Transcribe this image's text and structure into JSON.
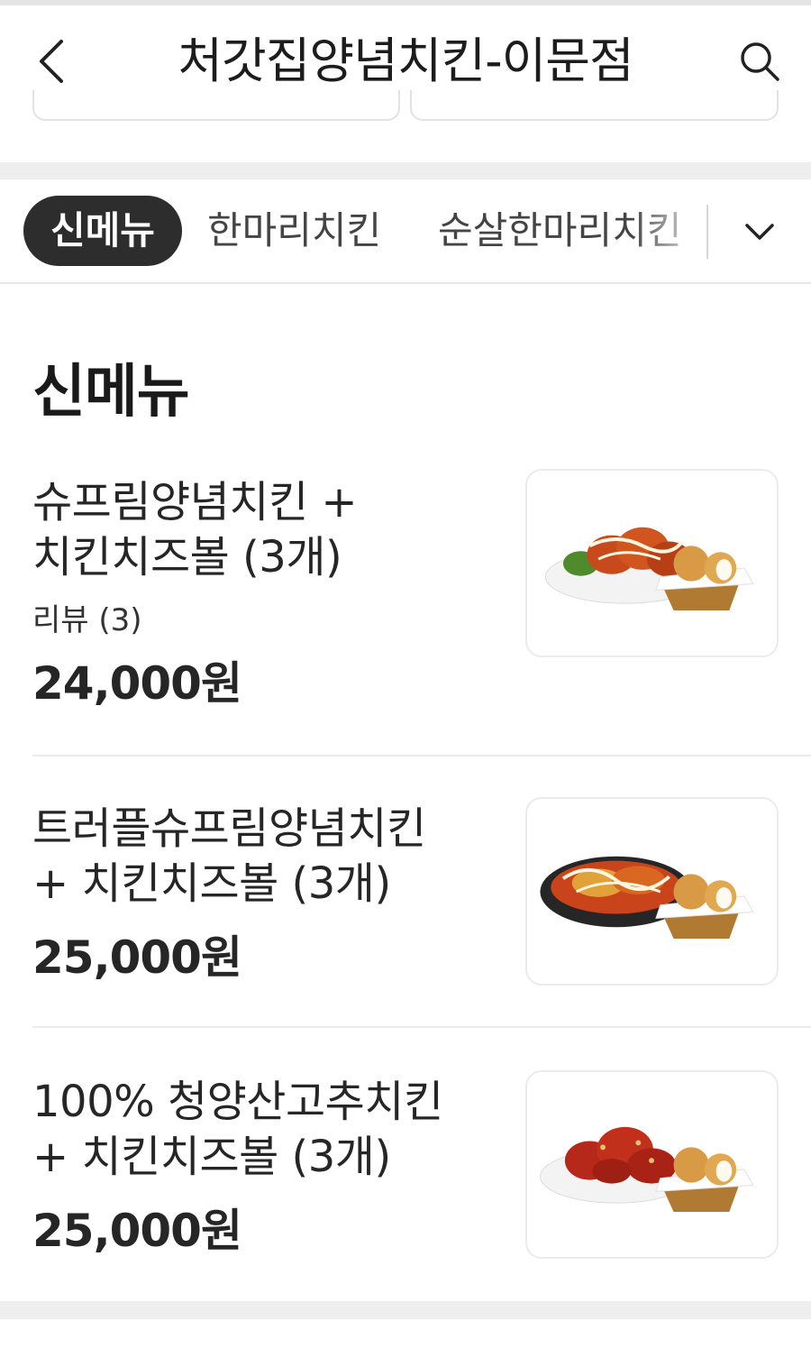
{
  "header": {
    "title": "처갓집양념치킨-이문점",
    "back_icon": "chevron-left-icon",
    "search_icon": "search-icon"
  },
  "tabs": {
    "items": [
      {
        "label": "신메뉴",
        "active": true
      },
      {
        "label": "한마리치킨",
        "active": false
      },
      {
        "label": "순살한마리치킨",
        "active": false
      }
    ],
    "expand_icon": "chevron-down-icon"
  },
  "section": {
    "title": "신메뉴",
    "items": [
      {
        "name_line1": "슈프림양념치킨 +",
        "name_line2": "치킨치즈볼 (3개)",
        "reviews": "리뷰 (3)",
        "price": "24,000원"
      },
      {
        "name_line1": "트러플슈프림양념치킨",
        "name_line2": "+ 치킨치즈볼 (3개)",
        "price": "25,000원"
      },
      {
        "name_line1": "100% 청양산고추치킨",
        "name_line2": "+ 치킨치즈볼 (3개)",
        "price": "25,000원"
      }
    ]
  },
  "colors": {
    "active_tab_bg": "#2d2d2d",
    "text": "#222222",
    "band": "#eeeeee"
  }
}
